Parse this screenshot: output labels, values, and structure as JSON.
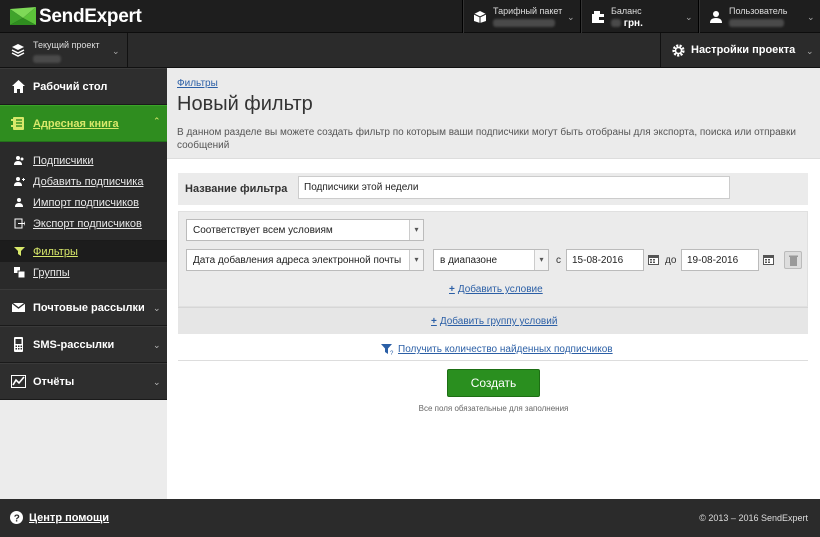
{
  "app": {
    "logo_text": "SendExpert"
  },
  "topbar": {
    "tariff_label": "Тарифный пакет",
    "balance_label": "Баланс",
    "balance_currency": "грн.",
    "user_label": "Пользователь"
  },
  "project": {
    "label": "Текущий проект"
  },
  "settings": {
    "label": "Настройки проекта"
  },
  "sidebar": {
    "dashboard": "Рабочий стол",
    "addressbook": "Адресная книга",
    "sub_items": [
      "Подписчики",
      "Добавить подписчика",
      "Импорт подписчиков",
      "Экспорт подписчиков"
    ],
    "filters": "Фильтры",
    "groups": "Группы",
    "mailings": "Почтовые рассылки",
    "sms": "SMS-рассылки",
    "reports": "Отчёты"
  },
  "main": {
    "breadcrumb": "Фильтры",
    "title": "Новый фильтр",
    "description": "В данном разделе вы можете создать фильтр по которым ваши подписчики могут быть отобраны для экспорта, поиска или отправки сообщений",
    "name_label": "Название фильтра",
    "name_value": "Подписчики этой недели",
    "match_select": "Соответствует всем условиям",
    "field_select": "Дата добавления адреса электронной почты",
    "operator_select": "в диапазоне",
    "from_label": "с",
    "from_date": "15-08-2016",
    "to_label": "до",
    "to_date": "19-08-2016",
    "add_condition": "Добавить условие",
    "add_group": "Добавить группу условий",
    "count_link": "Получить количество найденных подписчиков",
    "create_button": "Создать",
    "required_note": "Все поля обязательные для заполнения"
  },
  "footer": {
    "help": "Центр помощи",
    "copyright": "© 2013 – 2016 SendExpert"
  },
  "colors": {
    "accent_green": "#2a8f1f",
    "link_blue": "#2b5fa6",
    "dark": "#2b2b2b"
  }
}
